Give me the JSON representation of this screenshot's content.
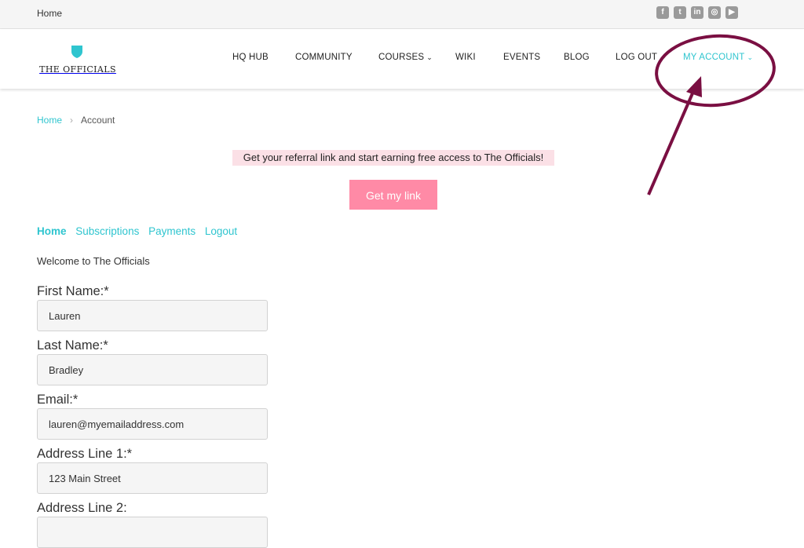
{
  "topbar": {
    "home_label": "Home",
    "social_icons": [
      "facebook-icon",
      "twitter-icon",
      "linkedin-icon",
      "instagram-icon",
      "youtube-icon"
    ]
  },
  "brand": {
    "name": "THE OFFICIALS",
    "accent": "#2fc5cf"
  },
  "nav": {
    "hq_hub": "HQ HUB",
    "community": "COMMUNITY",
    "courses": "COURSES",
    "wiki": "WIKI",
    "events": "EVENTS",
    "blog": "BLOG",
    "logout": "LOG OUT",
    "my_account": "MY ACCOUNT"
  },
  "breadcrumb": {
    "home": "Home",
    "current": "Account"
  },
  "promo": {
    "text": "Get your referral link and start earning free access to The Officials!",
    "button": "Get my link",
    "highlight_color": "#fbe0e6",
    "button_color": "#ff8aa6"
  },
  "account_nav": {
    "home": "Home",
    "subscriptions": "Subscriptions",
    "payments": "Payments",
    "logout": "Logout"
  },
  "welcome": "Welcome to The Officials",
  "form": {
    "first_name": {
      "label": "First Name:*",
      "value": "Lauren"
    },
    "last_name": {
      "label": "Last Name:*",
      "value": "Bradley"
    },
    "email": {
      "label": "Email:*",
      "value": "lauren@myemailaddress.com"
    },
    "address1": {
      "label": "Address Line 1:*",
      "value": "123 Main Street"
    },
    "address2": {
      "label": "Address Line 2:",
      "value": ""
    }
  },
  "annotation": {
    "color": "#7a0f42"
  }
}
